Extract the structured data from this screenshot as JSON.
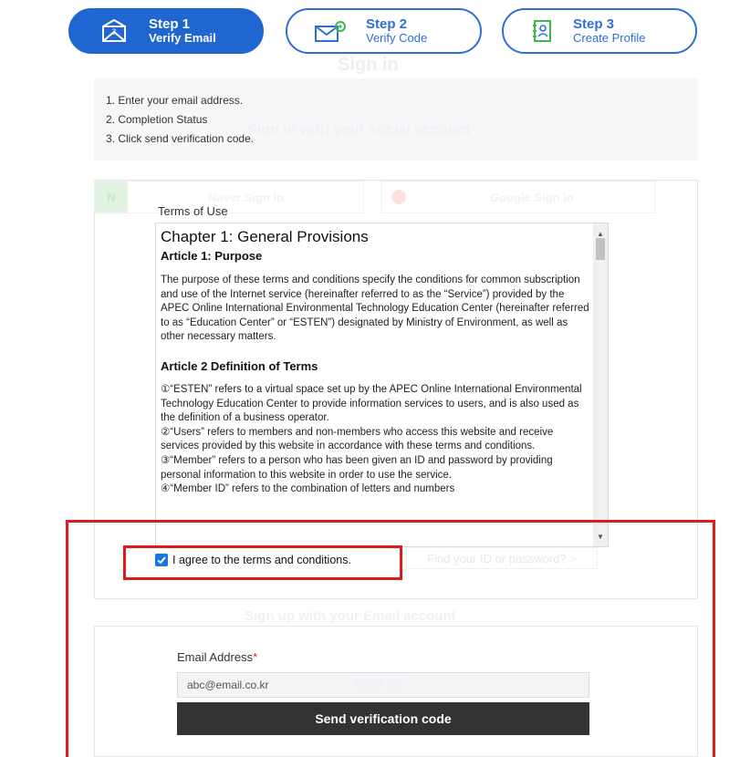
{
  "steps": [
    {
      "number": "Step 1",
      "label": "Verify Email",
      "icon": "email-icon",
      "active": true
    },
    {
      "number": "Step 2",
      "label": "Verify Code",
      "icon": "email-code-icon",
      "active": false
    },
    {
      "number": "Step 3",
      "label": "Create Profile",
      "icon": "profile-book-icon",
      "active": false
    }
  ],
  "instructions": [
    "1. Enter your email address.",
    "2. Completion Status",
    "3. Click send verification code."
  ],
  "background_ghost": {
    "sign_in": "Sign in",
    "social": "Sign in with your social account",
    "naver": "Naver Sign in",
    "google": "Google Sign in",
    "find": "Find your ID or password? >",
    "signup_heading": "Sign up with your Email account",
    "signup": "Sign up"
  },
  "terms": {
    "title": "Terms of Use",
    "chapter": "Chapter 1: General Provisions",
    "article1_title": "Article 1: Purpose",
    "article1_text": "The purpose of these terms and conditions specify the conditions for common subscription and use of the Internet service (hereinafter referred to as the “Service”) provided by the APEC Online International Environmental Technology Education Center (hereinafter referred to as “Education Center” or “ESTEN”) designated by Ministry of Environment, as well as other necessary matters.",
    "article2_title": "Article 2 Definition of Terms",
    "article2_text": "①“ESTEN” refers to a virtual space set up by the APEC Online International Environmental Technology Education Center to provide information services to users, and is also used as the definition of a business operator.\n②“Users” refers to members and non-members who access this website and receive services provided by this website in accordance with these terms and conditions.\n③“Member” refers to a person who has been given an ID and password by providing personal information to this website in order to use the service.\n④“Member ID” refers to the combination of letters and numbers"
  },
  "agree": {
    "label": "I agree to the terms and conditions.",
    "checked": true
  },
  "email": {
    "label": "Email Address",
    "required_mark": "*",
    "value": "abc@email.co.kr"
  },
  "send_button": "Send verification code",
  "colors": {
    "primary": "#1f66d1",
    "highlight": "#e01919",
    "button_dark": "#333333"
  }
}
